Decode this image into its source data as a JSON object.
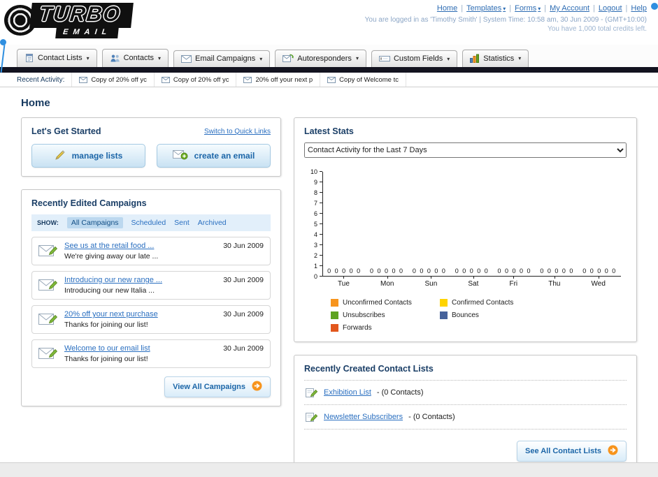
{
  "header": {
    "logo_title": "TURBO",
    "logo_subtitle": "EMAIL",
    "nav_links": [
      {
        "label": "Home",
        "dropdown": false
      },
      {
        "label": "Templates",
        "dropdown": true
      },
      {
        "label": "Forms",
        "dropdown": true
      },
      {
        "label": "My Account",
        "dropdown": false
      },
      {
        "label": "Logout",
        "dropdown": false
      },
      {
        "label": "Help",
        "dropdown": false
      }
    ],
    "login_info": "You are logged in as 'Timothy Smith' | System Time: 10:58 am, 30 Jun 2009 - (GMT+10:00)",
    "credits_info": "You have 1,000 total credits left."
  },
  "nav_tabs": [
    {
      "label": "Contact Lists",
      "icon": "list-icon"
    },
    {
      "label": "Contacts",
      "icon": "people-icon"
    },
    {
      "label": "Email Campaigns",
      "icon": "mail-icon"
    },
    {
      "label": "Autoresponders",
      "icon": "autoresponder-icon"
    },
    {
      "label": "Custom Fields",
      "icon": "field-icon"
    },
    {
      "label": "Statistics",
      "icon": "stats-icon"
    }
  ],
  "recent_activity": {
    "label": "Recent Activity:",
    "items": [
      "Copy of 20% off yc",
      "Copy of 20% off yc",
      "20% off your next p",
      "Copy of Welcome tc"
    ]
  },
  "page_title": "Home",
  "get_started": {
    "title": "Let's Get Started",
    "switch_link": "Switch to Quick Links",
    "manage_label": "manage lists",
    "create_label": "create an email"
  },
  "campaigns": {
    "title": "Recently Edited Campaigns",
    "show_label": "SHOW:",
    "filters": [
      "All Campaigns",
      "Scheduled",
      "Sent",
      "Archived"
    ],
    "selected_filter": "All Campaigns",
    "items": [
      {
        "title": "See us at the retail food ...",
        "subtitle": "We're giving away our late ...",
        "date": "30 Jun 2009"
      },
      {
        "title": "Introducing our new range ...",
        "subtitle": "Introducing our new Italia ...",
        "date": "30 Jun 2009"
      },
      {
        "title": "20% off your next purchase",
        "subtitle": "Thanks for joining our list!",
        "date": "30 Jun 2009"
      },
      {
        "title": "Welcome to our email list",
        "subtitle": "Thanks for joining our list!",
        "date": "30 Jun 2009"
      }
    ],
    "view_all_label": "View All Campaigns"
  },
  "stats": {
    "title": "Latest Stats",
    "dropdown_value": "Contact Activity for the Last 7 Days",
    "chart_data": {
      "type": "bar",
      "title": "Contact Activity for the Last 7 Days",
      "categories": [
        "Tue",
        "Mon",
        "Sun",
        "Sat",
        "Fri",
        "Thu",
        "Wed"
      ],
      "series": [
        {
          "name": "Unconfirmed Contacts",
          "color": "#f7941d",
          "values": [
            0,
            0,
            0,
            0,
            0,
            0,
            0
          ]
        },
        {
          "name": "Confirmed Contacts",
          "color": "#ffd400",
          "values": [
            0,
            0,
            0,
            0,
            0,
            0,
            0
          ]
        },
        {
          "name": "Unsubscribes",
          "color": "#5ea321",
          "values": [
            0,
            0,
            0,
            0,
            0,
            0,
            0
          ]
        },
        {
          "name": "Bounces",
          "color": "#46629b",
          "values": [
            0,
            0,
            0,
            0,
            0,
            0,
            0
          ]
        },
        {
          "name": "Forwards",
          "color": "#e2571d",
          "values": [
            0,
            0,
            0,
            0,
            0,
            0,
            0
          ]
        }
      ],
      "ylim": [
        0,
        10
      ],
      "yticks": [
        0,
        1,
        2,
        3,
        4,
        5,
        6,
        7,
        8,
        9,
        10
      ],
      "grid": false,
      "legend_position": "bottom"
    }
  },
  "contact_lists": {
    "title": "Recently Created Contact Lists",
    "items": [
      {
        "name": "Exhibition List",
        "detail": "- (0 Contacts)"
      },
      {
        "name": "Newsletter Subscribers",
        "detail": "- (0 Contacts)"
      }
    ],
    "see_all_label": "See All Contact Lists"
  }
}
